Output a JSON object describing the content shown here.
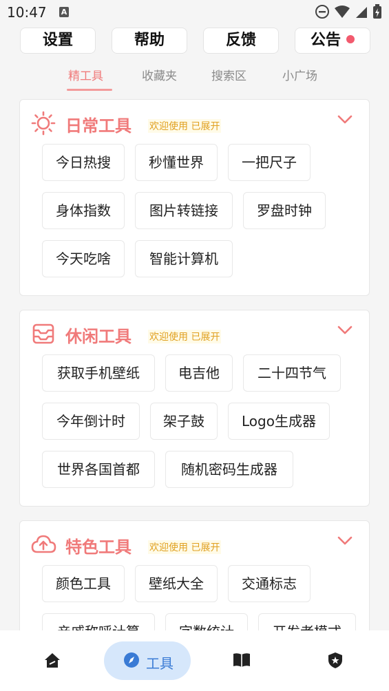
{
  "status": {
    "time": "10:47",
    "a_icon": "A"
  },
  "top_buttons": [
    {
      "label": "设置"
    },
    {
      "label": "帮助"
    },
    {
      "label": "反馈"
    },
    {
      "label": "公告",
      "dot_color": "#f25a6e"
    }
  ],
  "tabs": [
    "精工具",
    "收藏夹",
    "搜索区",
    "小广场"
  ],
  "active_tab": 0,
  "accent_color": "#f07a7a",
  "cards": [
    {
      "title": "日常工具",
      "subtitle": "欢迎使用 已展开",
      "icon": "sun-icon",
      "tools": [
        "今日热搜",
        "秒懂世界",
        "一把尺子",
        "身体指数",
        "图片转链接",
        "罗盘时钟",
        "今天吃啥",
        "智能计算机"
      ]
    },
    {
      "title": "休闲工具",
      "subtitle": "欢迎使用 已展开",
      "icon": "inbox-icon",
      "tools": [
        "获取手机壁纸",
        "电吉他",
        "二十四节气",
        "今年倒计时",
        "架子鼓",
        "Logo生成器",
        "世界各国首都",
        "随机密码生成器"
      ]
    },
    {
      "title": "特色工具",
      "subtitle": "欢迎使用 已展开",
      "icon": "cloud-upload-icon",
      "tools": [
        "颜色工具",
        "壁纸大全",
        "交通标志",
        "亲戚称呼计算",
        "字数统计",
        "开发者模式"
      ]
    }
  ],
  "bottom_nav": [
    {
      "icon": "home-icon",
      "label": ""
    },
    {
      "icon": "compass-icon",
      "label": "工具"
    },
    {
      "icon": "book-icon",
      "label": ""
    },
    {
      "icon": "shield-icon",
      "label": ""
    }
  ]
}
